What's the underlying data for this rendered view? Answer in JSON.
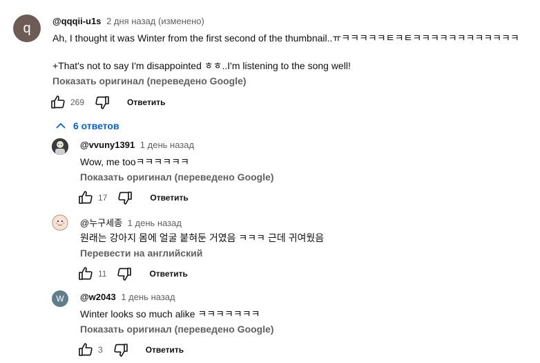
{
  "main_comment": {
    "avatar_letter": "q",
    "avatar_color": "#6d5c55",
    "author": "@qqqii-u1s",
    "time": "2 дня назад (изменено)",
    "line1": "Ah, I thought it was Winter from the first second of the thumbnail..ㅠㅋㅋㅋㅋㅋㅌㅋㅌㅋㅋㅋㅋㅋㅋㅋㅋㅋㅋㅋㅋ",
    "line2": "+That's not to say I'm disappointed ㅎㅎ..I'm listening to the song well!",
    "translate": "Показать оригинал (переведено Google)",
    "likes": "269",
    "reply": "Ответить"
  },
  "replies_toggle": {
    "label": "6 ответов",
    "color": "#065fd4"
  },
  "replies": [
    {
      "author": "@vvuny1391",
      "time": "1 день назад",
      "text": "Wow, me tooㅋㅋㅋㅋㅋㅋ",
      "translate": "Показать оригинал (переведено Google)",
      "likes": "17",
      "reply": "Ответить"
    },
    {
      "author": "@누구세종",
      "time": "1 день назад",
      "text": "원래는 강아지 몸에 얼굴 붙혀둔 거였음 ㅋㅋㅋ 근데 귀여웠음",
      "translate": "Перевести на английский",
      "likes": "11",
      "reply": "Ответить"
    },
    {
      "avatar_letter": "W",
      "avatar_color": "#607d8b",
      "author": "@w2043",
      "time": "1 день назад",
      "text": "Winter looks so much alike ㅋㅋㅋㅋㅋㅋㅋ",
      "translate": "Показать оригинал (переведено Google)",
      "likes": "3",
      "reply": "Ответить"
    }
  ],
  "icons": {
    "like": "thumbs-up-icon",
    "dislike": "thumbs-down-icon",
    "toggle": "chevron-up-icon"
  }
}
